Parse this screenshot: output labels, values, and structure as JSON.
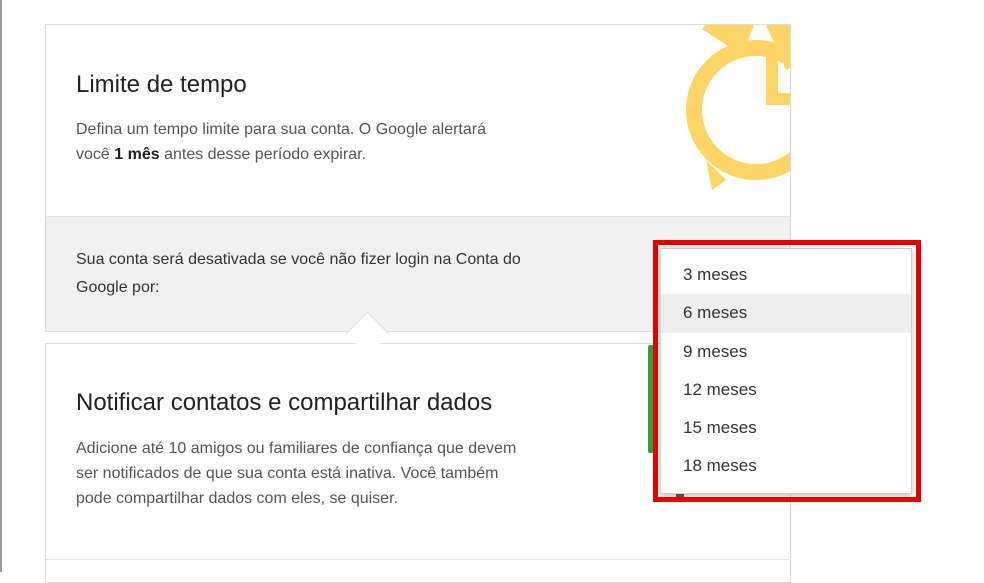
{
  "time_limit": {
    "title": "Limite de tempo",
    "desc_part1": "Defina um tempo limite para sua conta. O Google alertará",
    "desc_part2": "você ",
    "desc_bold": "1 mês",
    "desc_part3": " antes desse período expirar.",
    "deactivation_line1": "Sua conta será desativada se você não fizer login na Conta do",
    "deactivation_line2": "Google por:",
    "icon": "alarm-clock-icon",
    "icon_color": "#fdd466"
  },
  "notify": {
    "title": "Notificar contatos e compartilhar dados",
    "desc_line1": "Adicione até 10 amigos ou familiares de confiança que devem",
    "desc_line2": "ser notificados de que sua conta está inativa. Você também",
    "desc_line3": "pode compartilhar dados com eles, se quiser."
  },
  "dropdown": {
    "selected": "6 meses",
    "options": [
      "3 meses",
      "6 meses",
      "9 meses",
      "12 meses",
      "15 meses",
      "18 meses"
    ],
    "highlight_color": "#e60000"
  }
}
